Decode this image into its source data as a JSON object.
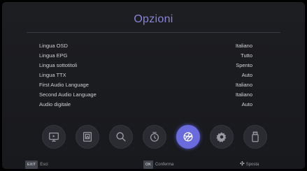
{
  "title": "Opzioni",
  "rows": [
    {
      "label": "Lingua OSD",
      "value": "Italiano"
    },
    {
      "label": "Lingua EPG",
      "value": "Tutto"
    },
    {
      "label": "Lingua sottotitoli",
      "value": "Spento"
    },
    {
      "label": "Lingua TTX",
      "value": "Auto"
    },
    {
      "label": "First Audio Language",
      "value": "Italiano"
    },
    {
      "label": "Second Audio Language",
      "value": "Italiano"
    },
    {
      "label": "Audio digitale",
      "value": "Auto"
    }
  ],
  "menu_icons": [
    "tv-icon",
    "picture-icon",
    "search-icon",
    "timer-icon",
    "options-icon",
    "settings-gear-icon",
    "usb-icon"
  ],
  "active_icon": "options-icon",
  "footer": {
    "exit_key": "EXIT",
    "exit_label": "Esci",
    "ok_key": "OK",
    "ok_label": "Conferma",
    "move_label": "Sposta"
  },
  "colors": {
    "accent": "#6a6cde",
    "title": "#8a83d8"
  }
}
